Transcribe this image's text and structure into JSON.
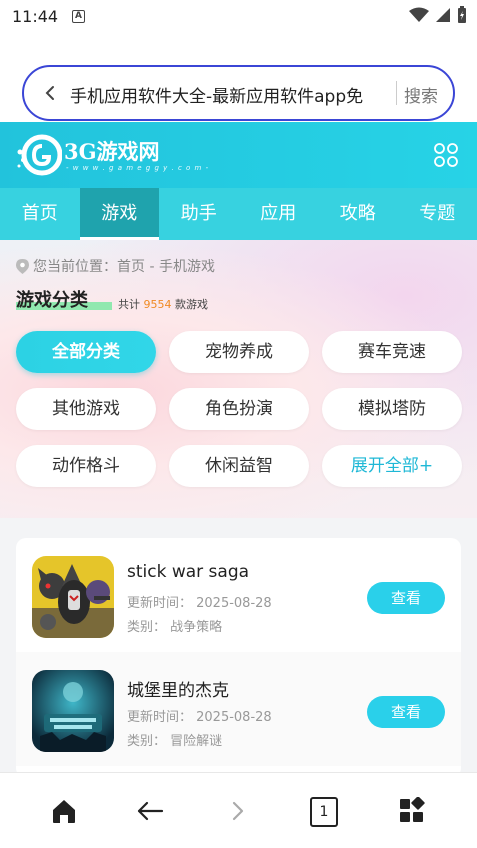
{
  "status_bar": {
    "time": "11:44",
    "notif_letter": "A"
  },
  "browser": {
    "address_text": "手机应用软件大全-最新应用软件app免",
    "search_label": "搜索"
  },
  "site": {
    "logo_text": "3G游戏网",
    "logo_sub": "- w w w . g a m e g g y . c o m -",
    "accent_color": "#2ad0ea"
  },
  "nav": {
    "items": [
      {
        "label": "首页"
      },
      {
        "label": "游戏"
      },
      {
        "label": "助手"
      },
      {
        "label": "应用"
      },
      {
        "label": "攻略"
      },
      {
        "label": "专题"
      }
    ],
    "active_index": 1
  },
  "category": {
    "breadcrumb": "您当前位置：首页 - 手机游戏",
    "title": "游戏分类",
    "count_prefix": "共计",
    "count": "9554",
    "count_suffix": "款游戏",
    "chips": [
      {
        "label": "全部分类"
      },
      {
        "label": "宠物养成"
      },
      {
        "label": "赛车竞速"
      },
      {
        "label": "其他游戏"
      },
      {
        "label": "角色扮演"
      },
      {
        "label": "模拟塔防"
      },
      {
        "label": "动作格斗"
      },
      {
        "label": "休闲益智"
      },
      {
        "label": "展开全部+"
      }
    ]
  },
  "games": [
    {
      "name": "stick war saga",
      "date": "更新时间：  2025-08-28",
      "category": "类别：  战争策略",
      "button": "查看"
    },
    {
      "name": "城堡里的杰克",
      "date": "更新时间：  2025-08-28",
      "category": "类别：  冒险解谜",
      "button": "查看"
    }
  ],
  "bottom_bar": {
    "tab_count": "1"
  }
}
